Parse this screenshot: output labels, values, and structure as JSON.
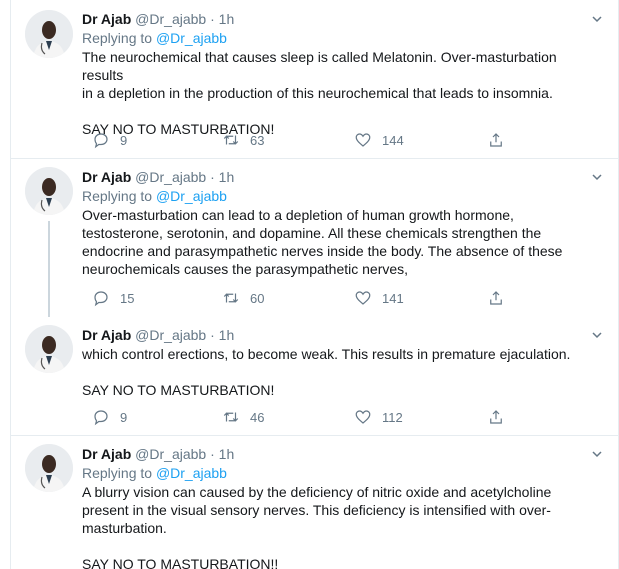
{
  "tweets": [
    {
      "name": "Dr Ajab",
      "handle": "@Dr_ajabb",
      "dot": "·",
      "time": "1h",
      "replying_prefix": "Replying to",
      "replying_to": "@Dr_ajabb",
      "text": "The neurochemical that causes sleep is called Melatonin. Over-masturbation results\nin a depletion in the production of this neurochemical that leads to insomnia.\n\nSAY NO TO MASTURBATION!",
      "replies": "9",
      "retweets": "63",
      "likes": "144"
    },
    {
      "name": "Dr Ajab",
      "handle": "@Dr_ajabb",
      "dot": "·",
      "time": "1h",
      "replying_prefix": "Replying to",
      "replying_to": "@Dr_ajabb",
      "text": "Over-masturbation can lead to a depletion of human growth hormone,\ntestosterone, serotonin, and dopamine. All these chemicals strengthen the\nendocrine and parasympathetic nerves inside the body. The absence of these\nneurochemicals causes the parasympathetic nerves,",
      "replies": "15",
      "retweets": "60",
      "likes": "141"
    },
    {
      "name": "Dr Ajab",
      "handle": "@Dr_ajabb",
      "dot": "·",
      "time": "1h",
      "text": "which control erections, to become weak. This results in premature ejaculation.\n\nSAY NO TO MASTURBATION!",
      "replies": "9",
      "retweets": "46",
      "likes": "112"
    },
    {
      "name": "Dr Ajab",
      "handle": "@Dr_ajabb",
      "dot": "·",
      "time": "1h",
      "replying_prefix": "Replying to",
      "replying_to": "@Dr_ajabb",
      "text": "A blurry vision can caused by the deficiency of nitric oxide and acetylcholine\npresent in the visual sensory nerves. This deficiency is intensified with over-\nmasturbation.\n\nSAY NO TO MASTURBATION!!"
    }
  ],
  "icons": {
    "reply": "reply-icon",
    "retweet": "retweet-icon",
    "like": "heart-icon",
    "share": "share-icon",
    "more": "chevron-down-icon"
  },
  "colors": {
    "text": "#14171a",
    "muted": "#657786",
    "link": "#1da1f2",
    "border": "#e6ecf0",
    "thread": "#ccd6dd"
  }
}
